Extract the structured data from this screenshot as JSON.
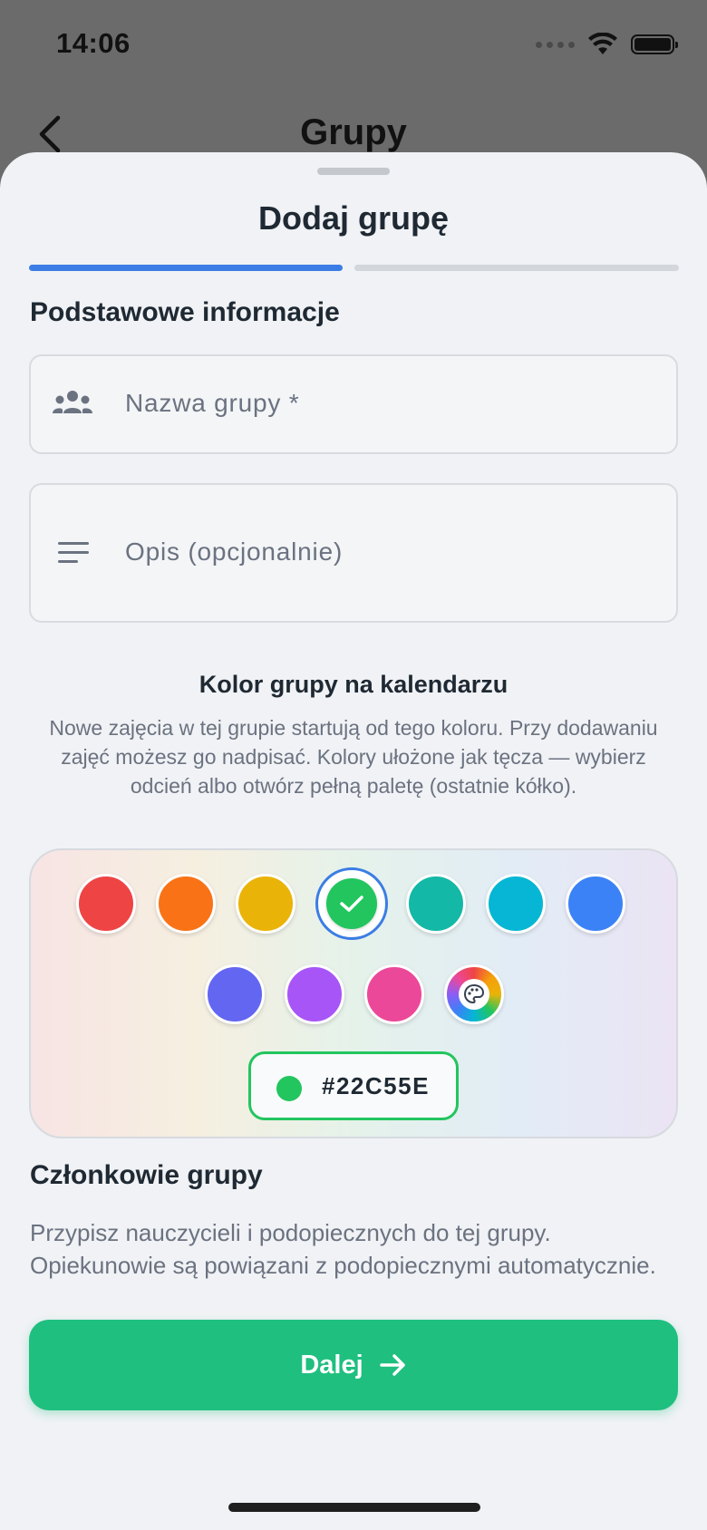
{
  "status_bar": {
    "time": "14:06"
  },
  "background_page": {
    "title": "Grupy"
  },
  "sheet": {
    "title": "Dodaj grupę",
    "progress": {
      "current_step": 1,
      "total_steps": 2
    },
    "basic_info": {
      "heading": "Podstawowe informacje",
      "name_placeholder": "Nazwa grupy *",
      "description_placeholder": "Opis (opcjonalnie)"
    },
    "color_section": {
      "title": "Kolor grupy na kalendarzu",
      "description": "Nowe zajęcia w tej grupie startują od tego koloru. Przy dodawaniu zajęć możesz go nadpisać. Kolory ułożone jak tęcza — wybierz odcień albo otwórz pełną paletę (ostatnie kółko).",
      "swatches": [
        "#ef4444",
        "#f97316",
        "#eab308",
        "#22c55e",
        "#14b8a6",
        "#06b6d4",
        "#3b82f6",
        "#6366f1",
        "#a855f7",
        "#ec4899"
      ],
      "selected_color": "#22c55e",
      "palette_icon": "palette-icon",
      "hex_value": "#22C55E"
    },
    "members": {
      "heading": "Członkowie grupy",
      "description": "Przypisz nauczycieli i podopiecznych do tej grupy. Opiekunowie są powiązani z podopiecznymi automatycznie."
    },
    "next_button": {
      "label": "Dalej",
      "icon": "arrow-right-icon"
    }
  },
  "colors": {
    "accent": "#3b7de4",
    "primary_button": "#1fbf7f"
  }
}
